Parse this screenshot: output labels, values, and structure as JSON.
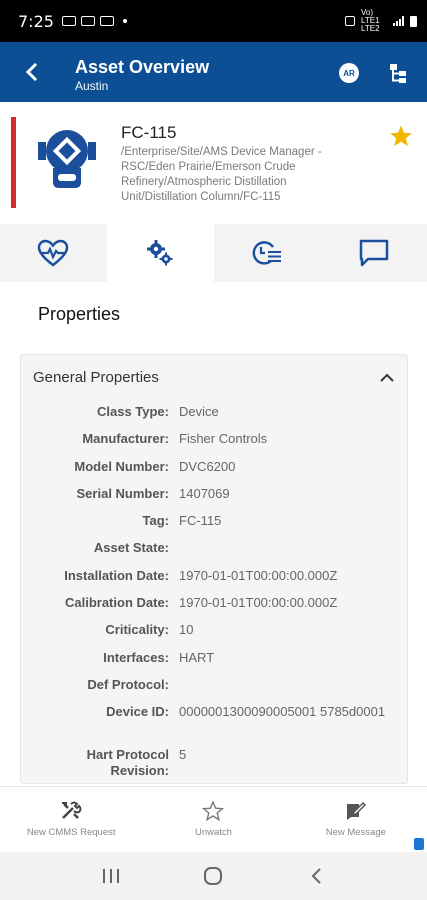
{
  "status_bar": {
    "time": "7:25",
    "network_label": "Vo) LTE1 LTE2"
  },
  "app_bar": {
    "title": "Asset Overview",
    "subtitle": "Austin",
    "ar_label": "AR"
  },
  "asset": {
    "tag": "FC-115",
    "path": "/Enterprise/Site/AMS Device Manager - RSC/Eden Prairie/Emerson Crude Refinery/Atmospheric Distillation Unit/Distillation Column/FC-115",
    "favorite": true,
    "status_color": "#d52b2b"
  },
  "tabs": [
    {
      "icon": "heart-pulse-icon",
      "active": false
    },
    {
      "icon": "gears-icon",
      "active": true
    },
    {
      "icon": "clock-list-icon",
      "active": false
    },
    {
      "icon": "chat-icon",
      "active": false
    }
  ],
  "section_title": "Properties",
  "general_properties": {
    "title": "General Properties",
    "rows": [
      {
        "label": "Class Type:",
        "value": "Device"
      },
      {
        "label": "Manufacturer:",
        "value": "Fisher Controls"
      },
      {
        "label": "Model Number:",
        "value": "DVC6200"
      },
      {
        "label": "Serial Number:",
        "value": "1407069"
      },
      {
        "label": "Tag:",
        "value": "FC-115"
      },
      {
        "label": "Asset State:",
        "value": ""
      },
      {
        "label": "Installation Date:",
        "value": "1970-01-01T00:00:00.000Z"
      },
      {
        "label": "Calibration Date:",
        "value": "1970-01-01T00:00:00.000Z"
      },
      {
        "label": "Criticality:",
        "value": "10"
      },
      {
        "label": "Interfaces:",
        "value": "HART"
      },
      {
        "label": "Def Protocol:",
        "value": ""
      },
      {
        "label": "Device ID:",
        "value": "0000001300090005001 5785d0001"
      },
      {
        "label": "Hart Protocol Revision:",
        "value": "5"
      }
    ]
  },
  "bottom_actions": [
    {
      "label": "New CMMS Request",
      "icon": "tools-icon"
    },
    {
      "label": "Unwatch",
      "icon": "star-outline-icon"
    },
    {
      "label": "New Message",
      "icon": "edit-message-icon"
    }
  ],
  "colors": {
    "brand_blue": "#0d4f95",
    "favorite_star": "#f2b600",
    "icon_blue": "#1b4f9c"
  }
}
